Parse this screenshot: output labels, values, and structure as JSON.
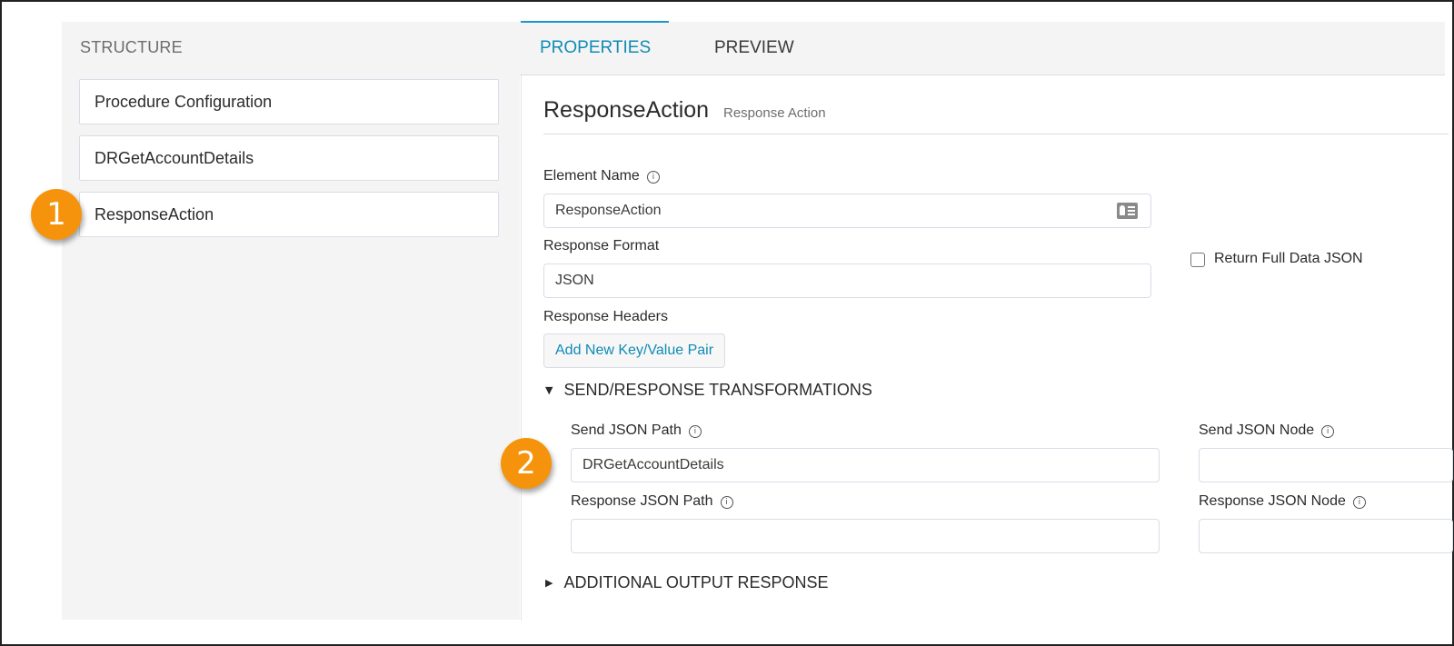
{
  "structure": {
    "title": "STRUCTURE",
    "items": [
      {
        "label": "Procedure Configuration"
      },
      {
        "label": "DRGetAccountDetails"
      },
      {
        "label": "ResponseAction"
      }
    ]
  },
  "tabs": [
    {
      "label": "PROPERTIES",
      "active": true
    },
    {
      "label": "PREVIEW",
      "active": false
    }
  ],
  "properties": {
    "element_title": "ResponseAction",
    "element_type": "Response Action",
    "element_name": {
      "label": "Element Name",
      "value": "ResponseAction",
      "icon": "contact-card-icon"
    },
    "response_format": {
      "label": "Response Format",
      "value": "JSON"
    },
    "return_full_data": {
      "label": "Return Full Data JSON",
      "checked": false
    },
    "response_headers": {
      "label": "Response Headers",
      "button": "Add New Key/Value Pair"
    },
    "send_response_section": {
      "label": "SEND/RESPONSE TRANSFORMATIONS",
      "expanded": true
    },
    "send_json_path": {
      "label": "Send JSON Path",
      "value": "DRGetAccountDetails"
    },
    "send_json_node": {
      "label": "Send JSON Node",
      "value": ""
    },
    "response_json_path": {
      "label": "Response JSON Path",
      "value": ""
    },
    "response_json_node": {
      "label": "Response JSON Node",
      "value": ""
    },
    "additional_output_section": {
      "label": "ADDITIONAL OUTPUT RESPONSE",
      "expanded": false
    }
  },
  "callouts": [
    {
      "number": "1",
      "color": "#f5940c"
    },
    {
      "number": "2",
      "color": "#f5940c"
    }
  ],
  "colors": {
    "accent": "#0f8bb5",
    "callout": "#f5940c"
  }
}
